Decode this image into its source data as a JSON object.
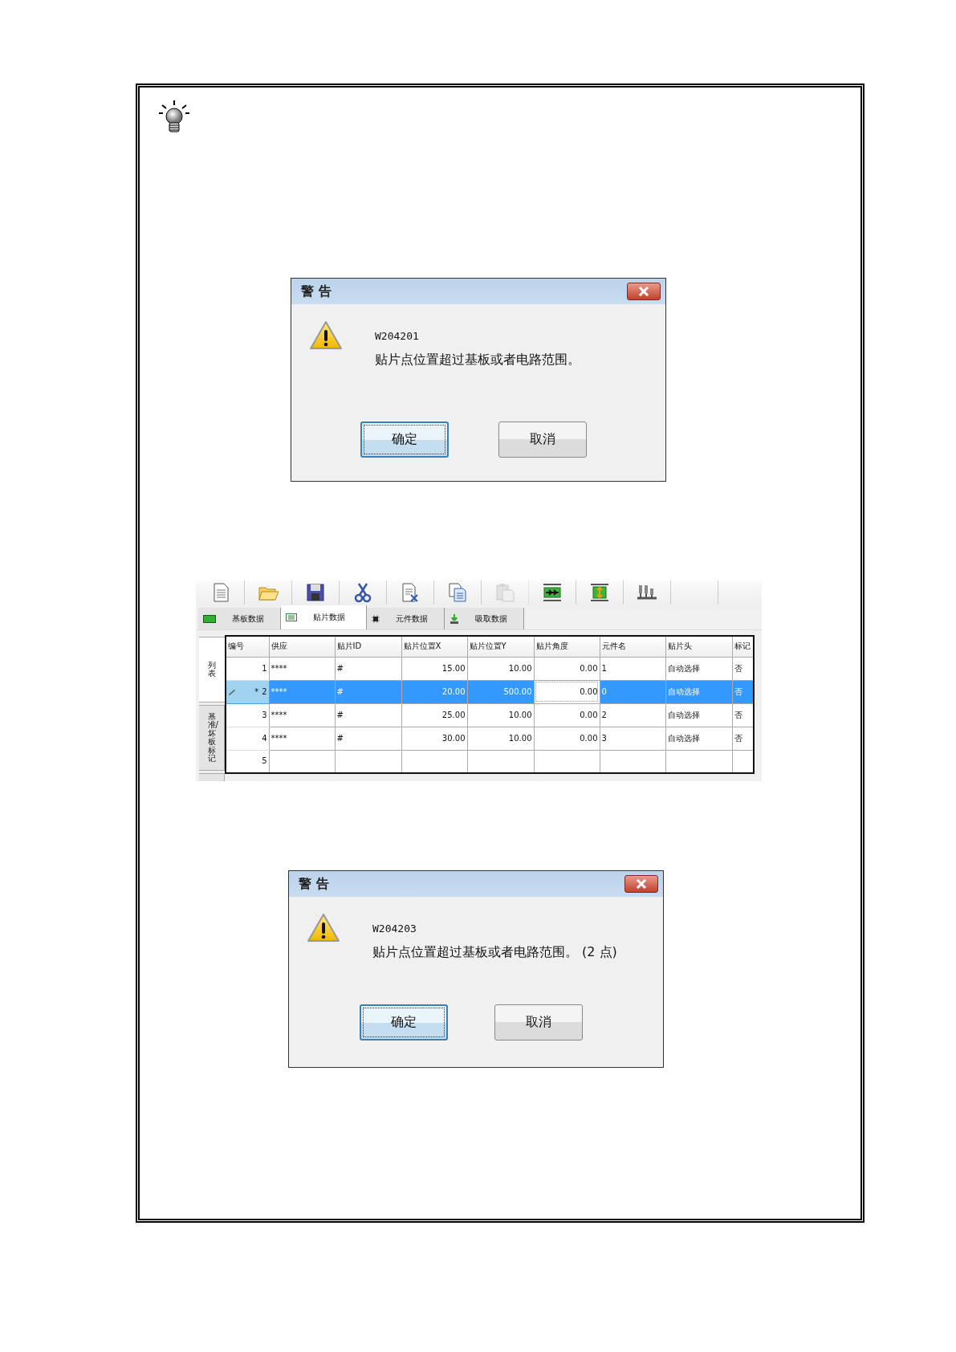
{
  "dialogs": [
    {
      "title": "警 告",
      "code": "W204201",
      "message": "贴片点位置超过基板或者电路范围。",
      "buttons": [
        {
          "label": "确定",
          "focused": true
        },
        {
          "label": "取消",
          "focused": false
        }
      ]
    },
    {
      "title": "警 告",
      "code": "W204203",
      "message": "贴片点位置超过基板或者电路范围。 (2 点)",
      "buttons": [
        {
          "label": "确定",
          "focused": true
        },
        {
          "label": "取消",
          "focused": false
        }
      ]
    }
  ],
  "editor": {
    "toolbar": [
      {
        "kind": "new",
        "disabled": false
      },
      {
        "kind": "open",
        "disabled": false
      },
      {
        "kind": "save",
        "disabled": false
      },
      {
        "kind": "cut",
        "disabled": false
      },
      {
        "kind": "delete",
        "disabled": false
      },
      {
        "kind": "copy",
        "disabled": false
      },
      {
        "kind": "paste",
        "disabled": true
      },
      {
        "kind": "horizontal",
        "disabled": false
      },
      {
        "kind": "vertical",
        "disabled": false
      },
      {
        "kind": "nozzles",
        "disabled": false
      }
    ],
    "tabs": [
      {
        "label": "基板数据",
        "kind": "board",
        "selected": false
      },
      {
        "label": "贴片数据",
        "kind": "grid",
        "selected": true
      },
      {
        "label": "元件数据",
        "kind": "chip",
        "selected": false
      },
      {
        "label": "吸取数据",
        "kind": "pickup",
        "selected": false
      }
    ],
    "side_tabs": [
      {
        "label": "列表",
        "selected": true
      },
      {
        "label": "基准/坏板标记",
        "selected": false
      },
      {
        "selected": false
      }
    ],
    "table": {
      "columns": [
        "编号",
        "供应",
        "贴片ID",
        "贴片位置X",
        "贴片位置Y",
        "贴片角度",
        "元件名",
        "贴片头",
        "标记"
      ],
      "rows": [
        {
          "editing": false,
          "selected": false,
          "cells": [
            {
              "text": "1",
              "current": false
            },
            {
              "text": "****",
              "current": false
            },
            {
              "text": "#",
              "current": false
            },
            {
              "text": "15.00",
              "current": false
            },
            {
              "text": "10.00",
              "current": false
            },
            {
              "text": "0.00",
              "current": false
            },
            {
              "text": "1",
              "current": false
            },
            {
              "text": "自动选择",
              "current": false
            },
            {
              "text": "否",
              "current": false
            }
          ]
        },
        {
          "marker": "*",
          "editing": true,
          "selected": true,
          "cells": [
            {
              "text": "2",
              "current": false
            },
            {
              "text": "****",
              "current": false
            },
            {
              "text": "#",
              "current": false
            },
            {
              "text": "20.00",
              "current": false
            },
            {
              "text": "500.00",
              "current": false
            },
            {
              "text": "0.00",
              "current": true
            },
            {
              "text": "0",
              "current": false
            },
            {
              "text": "自动选择",
              "current": false
            },
            {
              "text": "否",
              "current": false
            }
          ]
        },
        {
          "editing": false,
          "selected": false,
          "cells": [
            {
              "text": "3",
              "current": false
            },
            {
              "text": "****",
              "current": false
            },
            {
              "text": "#",
              "current": false
            },
            {
              "text": "25.00",
              "current": false
            },
            {
              "text": "10.00",
              "current": false
            },
            {
              "text": "0.00",
              "current": false
            },
            {
              "text": "2",
              "current": false
            },
            {
              "text": "自动选择",
              "current": false
            },
            {
              "text": "否",
              "current": false
            }
          ]
        },
        {
          "editing": false,
          "selected": false,
          "cells": [
            {
              "text": "4",
              "current": false
            },
            {
              "text": "****",
              "current": false
            },
            {
              "text": "#",
              "current": false
            },
            {
              "text": "30.00",
              "current": false
            },
            {
              "text": "10.00",
              "current": false
            },
            {
              "text": "0.00",
              "current": false
            },
            {
              "text": "3",
              "current": false
            },
            {
              "text": "自动选择",
              "current": false
            },
            {
              "text": "否",
              "current": false
            }
          ]
        },
        {
          "editing": false,
          "selected": false,
          "cells": [
            {
              "text": "5",
              "current": false
            }
          ]
        }
      ]
    }
  }
}
